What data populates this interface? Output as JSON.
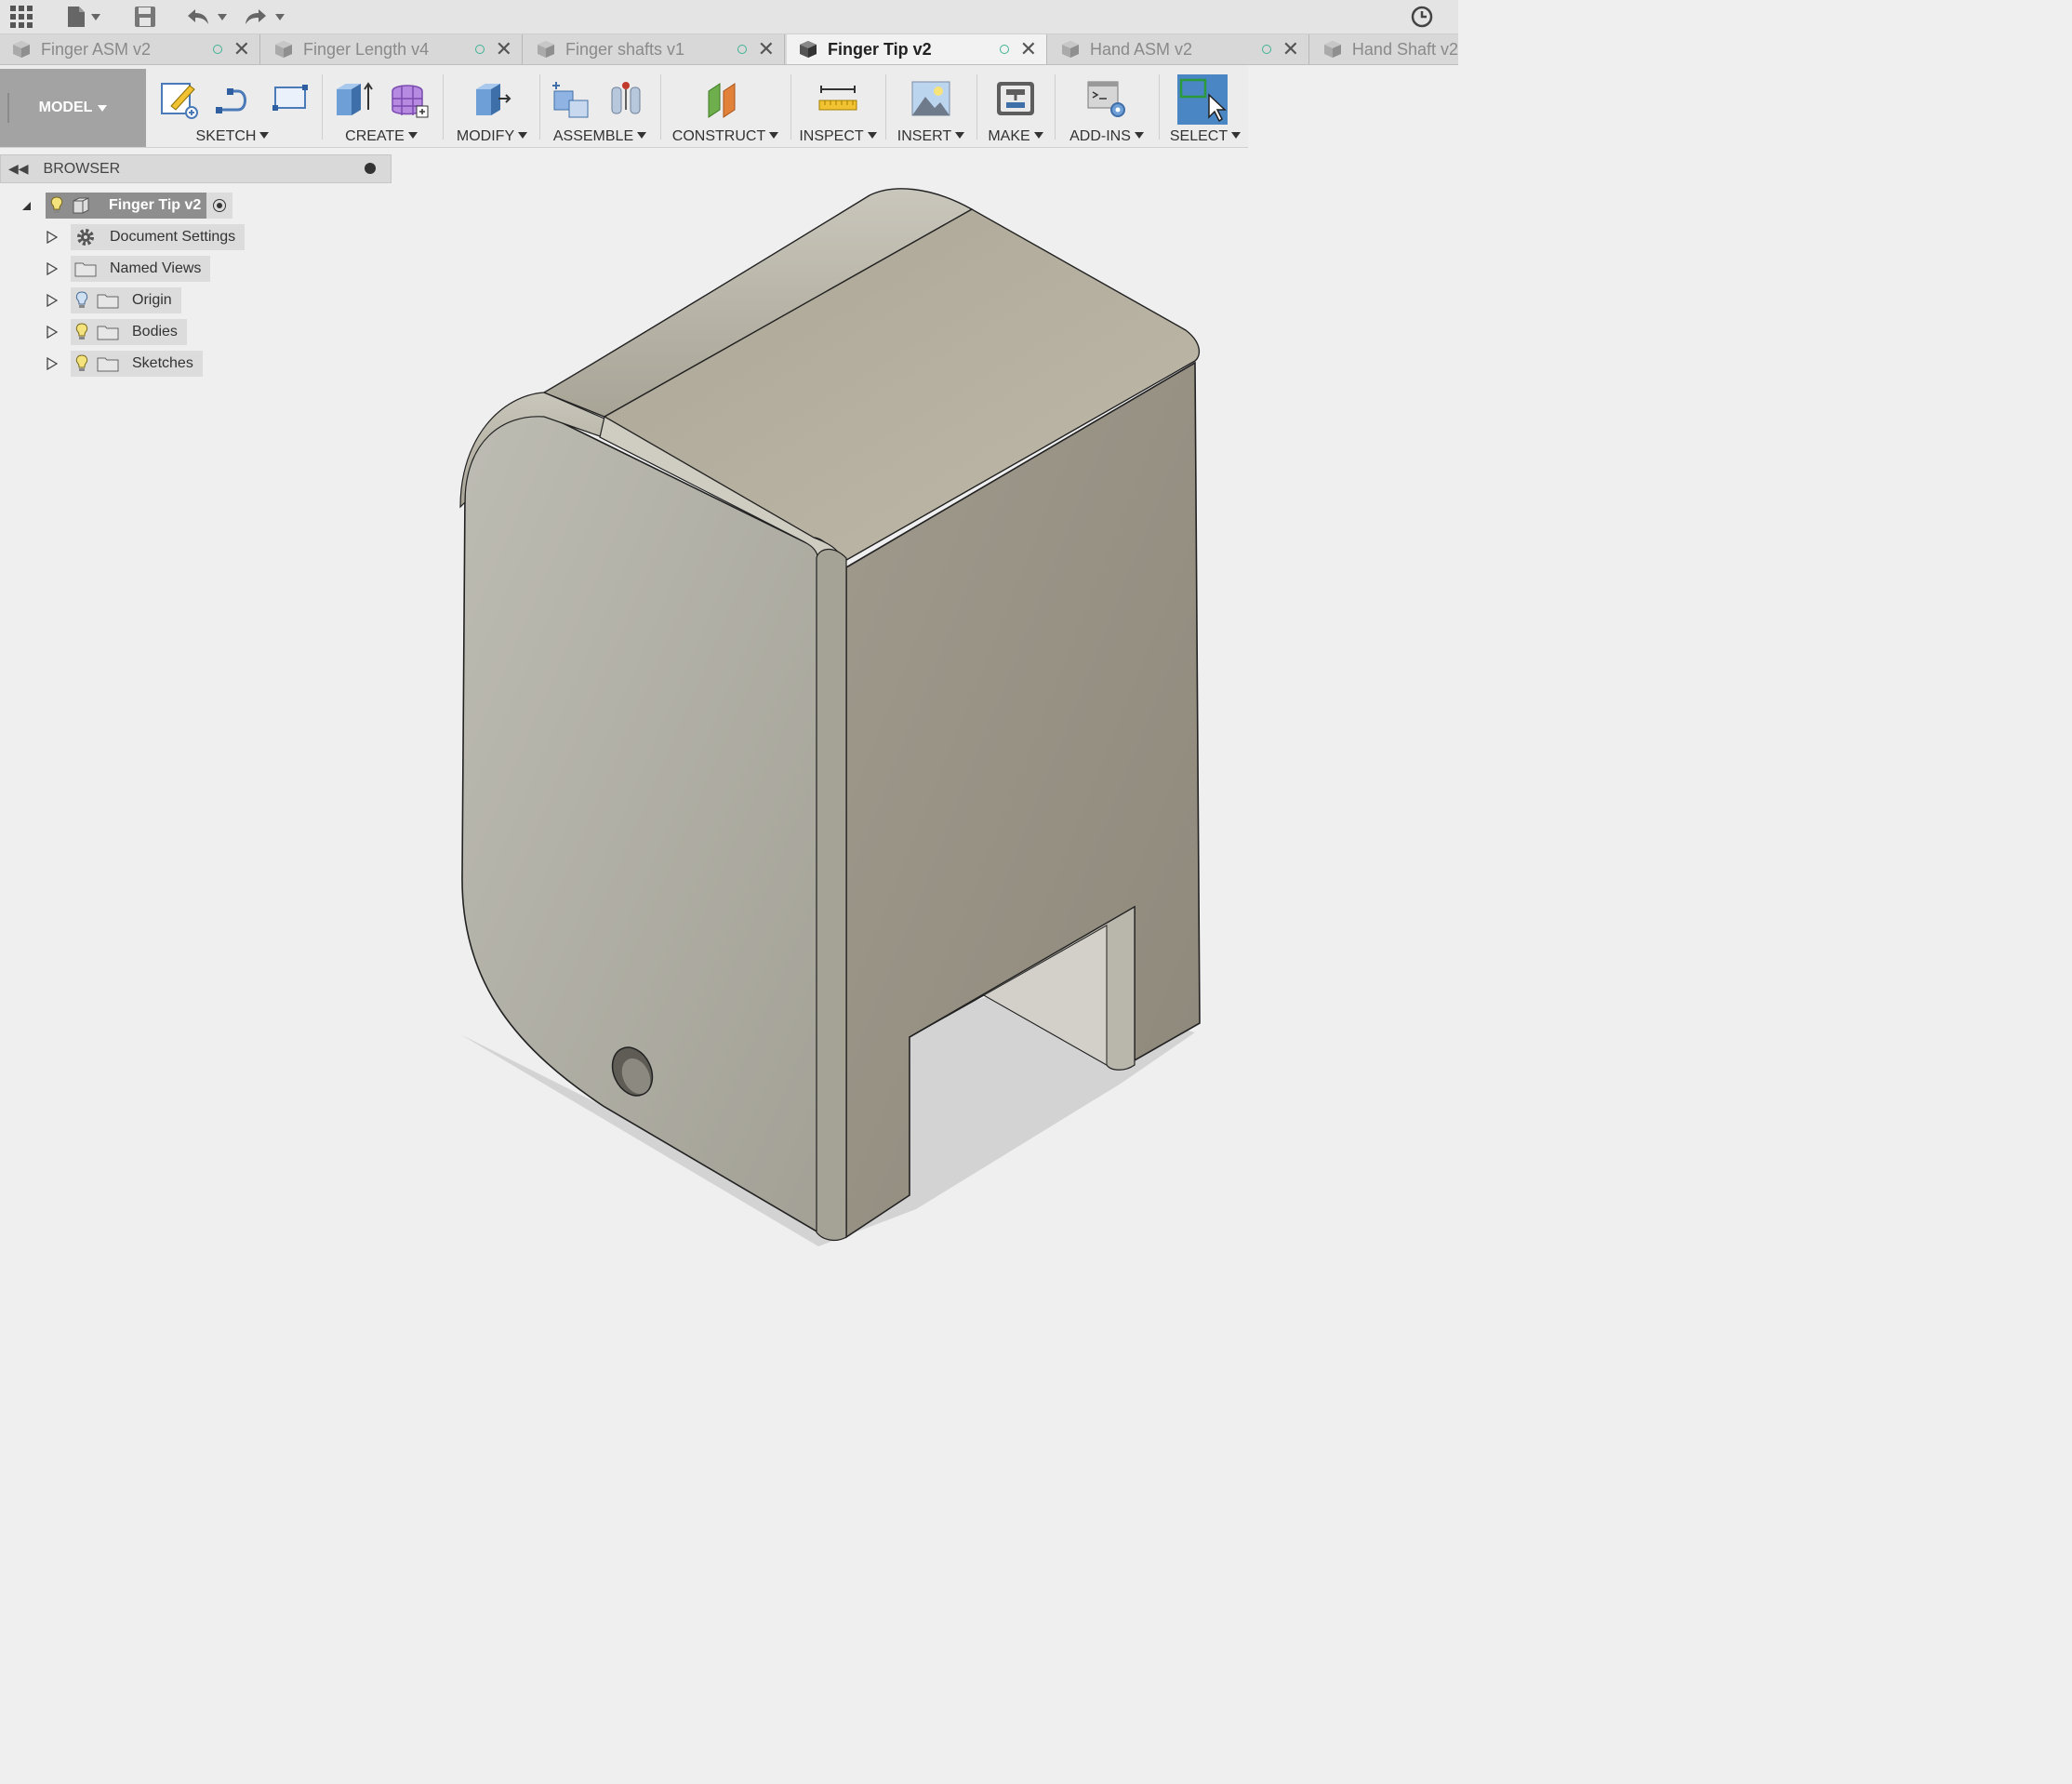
{
  "tabs": [
    {
      "label": "Finger ASM v2"
    },
    {
      "label": "Finger Length v4"
    },
    {
      "label": "Finger shafts v1"
    },
    {
      "label": "Finger Tip v2"
    },
    {
      "label": "Hand ASM v2"
    },
    {
      "label": "Hand Shaft v2"
    }
  ],
  "ribbon": {
    "workspace": "MODEL",
    "groups": {
      "sketch": "SKETCH",
      "create": "CREATE",
      "modify": "MODIFY",
      "assemble": "ASSEMBLE",
      "construct": "CONSTRUCT",
      "inspect": "INSPECT",
      "insert": "INSERT",
      "make": "MAKE",
      "addins": "ADD-INS",
      "select": "SELECT"
    }
  },
  "browser": {
    "title": "BROWSER",
    "root": "Finger Tip v2",
    "items": [
      {
        "label": "Document Settings"
      },
      {
        "label": "Named Views"
      },
      {
        "label": "Origin"
      },
      {
        "label": "Bodies"
      },
      {
        "label": "Sketches"
      }
    ]
  },
  "colors": {
    "active_select": "#4a85c4",
    "status_dot": "#3fb394",
    "model_fill": "#a9a79b"
  },
  "icons": [
    "grid-menu-icon",
    "file-icon",
    "save-icon",
    "undo-icon",
    "redo-icon",
    "clock-icon",
    "document-cube-icon",
    "lightbulb-icon",
    "gear-icon",
    "folder-icon",
    "radio-icon"
  ]
}
